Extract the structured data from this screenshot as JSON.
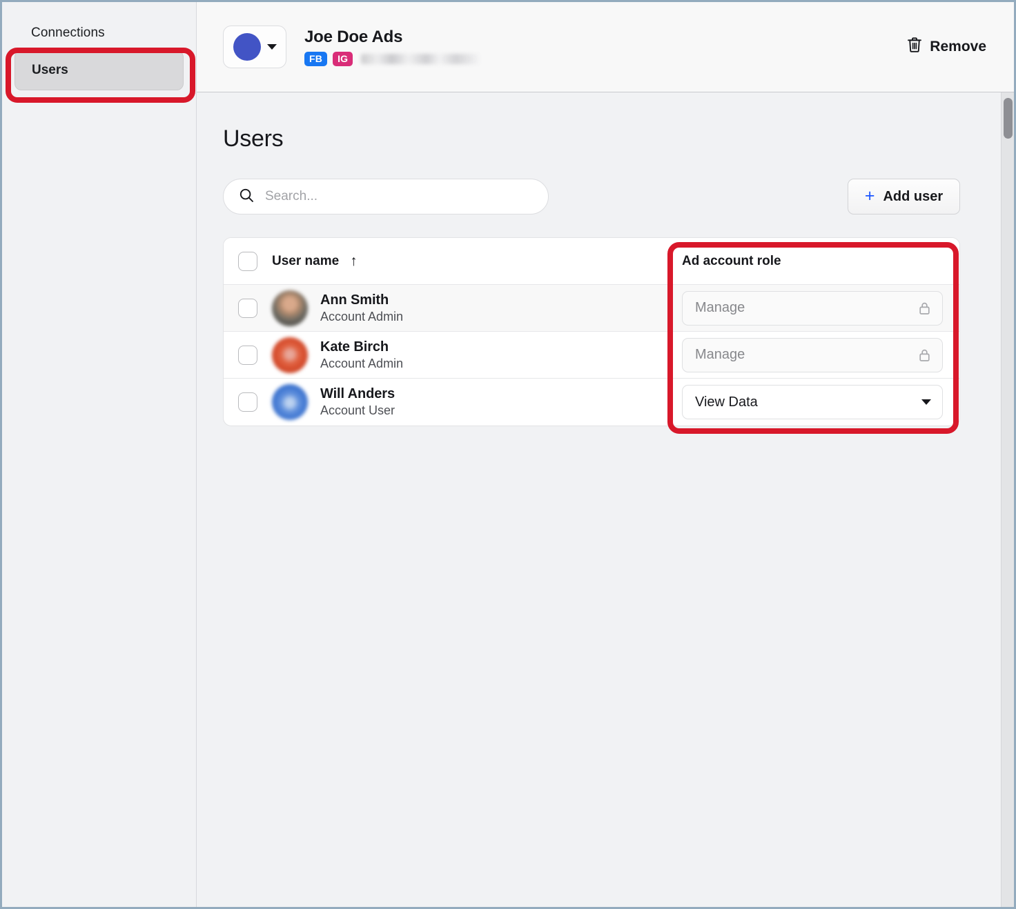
{
  "sidebar": {
    "section_label": "Connections",
    "items": [
      {
        "label": "Users",
        "active": true
      }
    ]
  },
  "header": {
    "account_name": "Joe Doe Ads",
    "avatar_color": "#4254c5",
    "badges": [
      {
        "label": "FB",
        "color": "#1877f2"
      },
      {
        "label": "IG",
        "color": "#d92d78"
      }
    ],
    "email_redacted": "",
    "remove_label": "Remove",
    "trash_icon": "trash-icon",
    "dropdown_icon": "chevron-down-icon"
  },
  "main": {
    "title": "Users",
    "search": {
      "placeholder": "Search...",
      "value": "",
      "icon": "search-icon"
    },
    "add_user": {
      "label": "Add user",
      "plus": "+",
      "plus_color": "#1a54ff"
    },
    "table": {
      "columns": {
        "user_name": "User name",
        "sort_indicator": "↑",
        "ad_account_role": "Ad account role"
      },
      "rows": [
        {
          "name": "Ann Smith",
          "role_label": "Account Admin",
          "ad_account_role": "Manage",
          "locked": true,
          "avatar": "avatar-ann-smith"
        },
        {
          "name": "Kate Birch",
          "role_label": "Account Admin",
          "ad_account_role": "Manage",
          "locked": true,
          "avatar": "avatar-kate-birch"
        },
        {
          "name": "Will Anders",
          "role_label": "Account User",
          "ad_account_role": "View Data",
          "locked": false,
          "avatar": "avatar-will-anders"
        }
      ]
    }
  },
  "annotations": {
    "highlight_color": "#d8182a",
    "targets": [
      "sidebar-item-users",
      "ad-account-role-column"
    ]
  }
}
